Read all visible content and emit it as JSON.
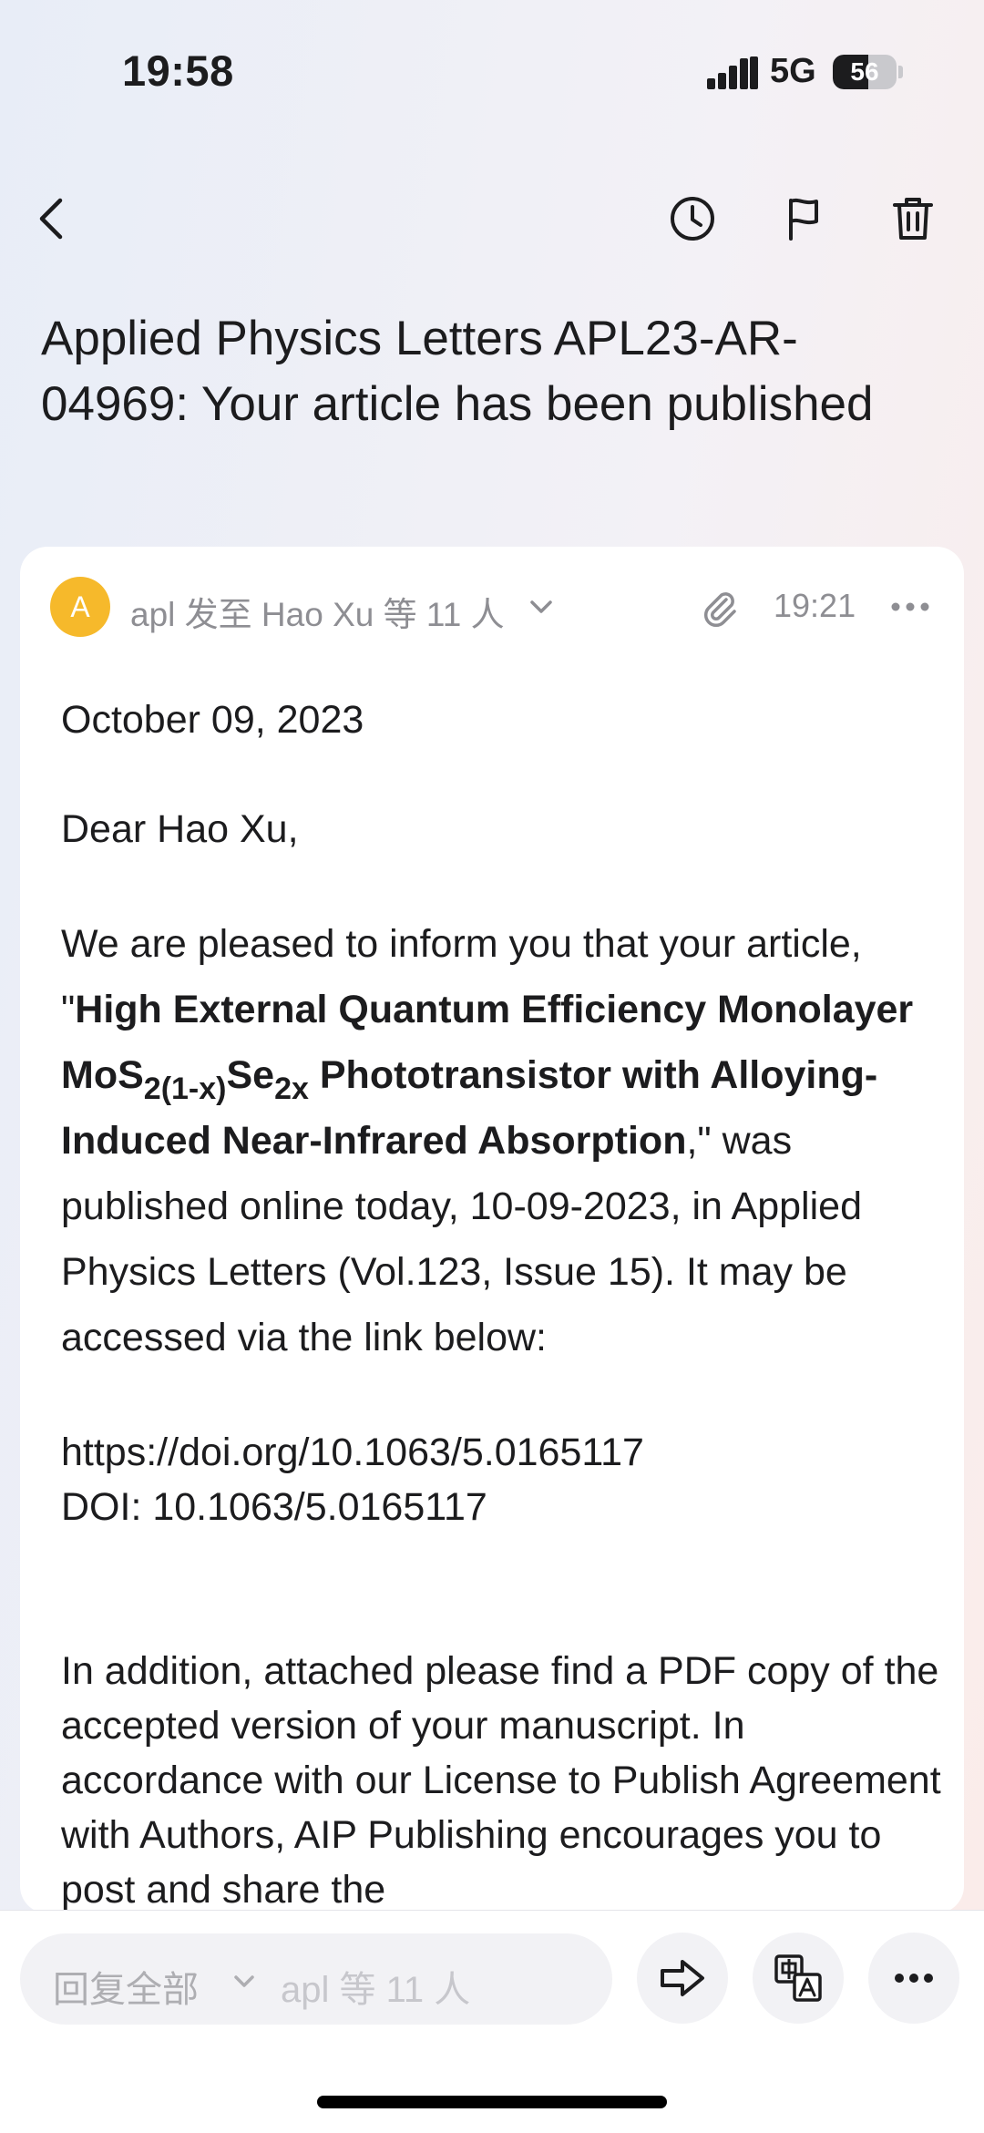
{
  "status_bar": {
    "time": "19:58",
    "network": "5G",
    "battery_level": 56,
    "battery_text": "56"
  },
  "nav": {
    "icons": [
      "back-icon",
      "clock-icon",
      "flag-icon",
      "trash-icon"
    ]
  },
  "email": {
    "subject": "Applied Physics Letters APL23-AR-04969: Your article has been published",
    "sender": {
      "avatar_letter": "A",
      "summary": "apl 发至 Hao Xu 等 11 人",
      "time": "19:21"
    },
    "body": {
      "date": "October 09, 2023",
      "greeting": "Dear Hao Xu,",
      "p1_intro": "We are pleased to inform you that your article, \"",
      "title_a": "High External Quantum Efficiency Monolayer MoS",
      "title_sub1": "2(1-x)",
      "title_b": "Se",
      "title_sub2": "2x",
      "title_c": " Phototransistor with Alloying-Induced Near-Infrared Absorption",
      "p1_rest": ",\" was published online today, 10-09-2023, in Applied Physics Letters (Vol.123, Issue 15). It may be accessed via the link below:",
      "link": "https://doi.org/10.1063/5.0165117",
      "doi": "DOI: 10.1063/5.0165117",
      "p2": "In addition, attached please find a PDF copy of the accepted version of your manuscript. In accordance with our License to Publish Agreement with Authors, AIP Publishing encourages you to post and share the"
    }
  },
  "bottom_bar": {
    "reply_label": "回复全部",
    "reply_to": "apl 等 11 人",
    "icons": [
      "forward-icon",
      "translate-icon",
      "more-icon"
    ]
  },
  "colors": {
    "avatar": "#f6b92b",
    "card": "#ffffff",
    "muted_text": "#8e8e93"
  }
}
